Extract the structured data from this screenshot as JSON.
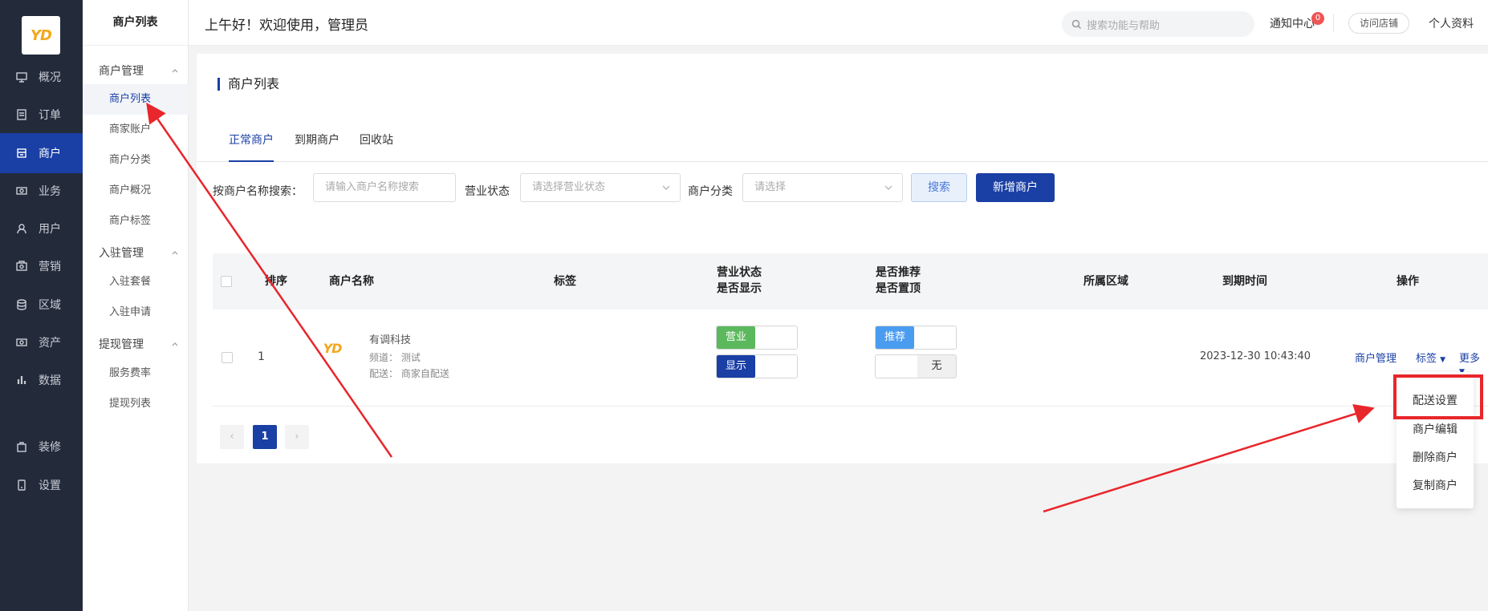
{
  "app": {
    "logo_text": "YD"
  },
  "leftnav": {
    "items": [
      {
        "label": "概况",
        "icon": "dashboard-icon"
      },
      {
        "label": "订单",
        "icon": "order-icon"
      },
      {
        "label": "商户",
        "icon": "merchant-icon",
        "active": true
      },
      {
        "label": "业务",
        "icon": "business-icon"
      },
      {
        "label": "用户",
        "icon": "user-icon"
      },
      {
        "label": "营销",
        "icon": "marketing-icon"
      },
      {
        "label": "区域",
        "icon": "region-icon"
      },
      {
        "label": "资产",
        "icon": "asset-icon"
      },
      {
        "label": "数据",
        "icon": "data-chart-icon"
      },
      {
        "label": "装修",
        "icon": "decorate-icon"
      },
      {
        "label": "设置",
        "icon": "settings-icon"
      }
    ]
  },
  "submenu": {
    "title": "商户列表",
    "groups": [
      {
        "label": "商户管理",
        "items": [
          "商户列表",
          "商家账户",
          "商户分类",
          "商户概况",
          "商户标签"
        ]
      },
      {
        "label": "入驻管理",
        "items": [
          "入驻套餐",
          "入驻申请"
        ]
      },
      {
        "label": "提现管理",
        "items": [
          "服务费率",
          "提现列表"
        ]
      }
    ]
  },
  "header": {
    "greeting": "上午好！欢迎使用，管理员",
    "search_placeholder": "搜索功能与帮助",
    "notify_label": "通知中心",
    "notify_count": "0",
    "visit_label": "访问店铺",
    "profile_label": "个人资料"
  },
  "page": {
    "title": "商户列表",
    "tabs": [
      "正常商户",
      "到期商户",
      "回收站"
    ],
    "filters": {
      "name_label": "按商户名称搜索：",
      "name_placeholder": "请输入商户名称搜索",
      "status_label": "营业状态",
      "status_placeholder": "请选择营业状态",
      "category_label": "商户分类",
      "category_placeholder": "请选择",
      "search_button": "搜索",
      "add_button": "新增商户"
    }
  },
  "table": {
    "headers": {
      "sort": "排序",
      "name": "商户名称",
      "tags": "标签",
      "status_line1": "营业状态",
      "status_line2": "是否显示",
      "recommend_line1": "是否推荐",
      "recommend_line2": "是否置顶",
      "region": "所属区域",
      "expire": "到期时间",
      "ops": "操作"
    },
    "rows": [
      {
        "sort": "1",
        "logo_text": "YD",
        "name": "有调科技",
        "channel": "频道： 测试",
        "delivery": "配送： 商家自配送",
        "status_on": "营业",
        "display_on": "显示",
        "recommend_on": "推荐",
        "top_off": "无",
        "region": "",
        "expire": "2023-12-30 10:43:40",
        "op_manage": "商户管理",
        "op_tags": "标签",
        "op_more": "更多"
      }
    ]
  },
  "pagination": {
    "prev": "‹",
    "current": "1",
    "next": "›"
  },
  "more_menu": {
    "items": [
      "配送设置",
      "商户编辑",
      "删除商户",
      "复制商户"
    ]
  },
  "colors": {
    "primary": "#1a3fa5",
    "nav_bg": "#232b3b",
    "green": "#5cb85c",
    "blue_light": "#4a9cf0",
    "annotation_red": "#e8262b"
  }
}
